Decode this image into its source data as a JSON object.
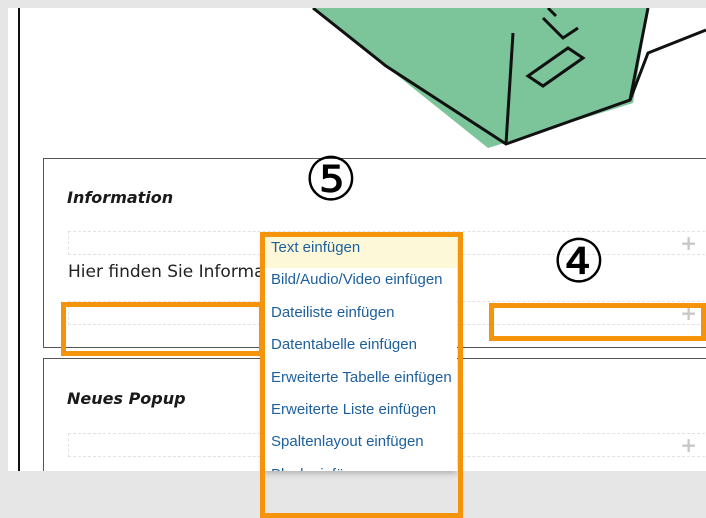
{
  "sections": [
    {
      "title": "Information",
      "body_text": "Hier finden Sie Informationen",
      "add_symbol": "+"
    },
    {
      "title": "Neues Popup",
      "add_symbol": "+"
    }
  ],
  "insert_menu": {
    "items": [
      {
        "label": "Text einfügen",
        "active": true
      },
      {
        "label": "Bild/Audio/Video einfügen"
      },
      {
        "label": "Dateiliste einfügen"
      },
      {
        "label": "Datentabelle einfügen"
      },
      {
        "label": "Erweiterte Tabelle einfügen"
      },
      {
        "label": "Erweiterte Liste einfügen"
      },
      {
        "label": "Spaltenlayout einfügen"
      },
      {
        "label": "Block einfügen"
      }
    ]
  },
  "callouts": {
    "five": "⑤",
    "four": "④"
  },
  "colors": {
    "highlight": "#f5930b",
    "illustration_green": "#7cc49a",
    "menu_link": "#1d5f9e",
    "menu_active_bg": "#fdf9d8"
  },
  "icons": [
    "plus-icon",
    "plus-icon",
    "plus-icon"
  ]
}
